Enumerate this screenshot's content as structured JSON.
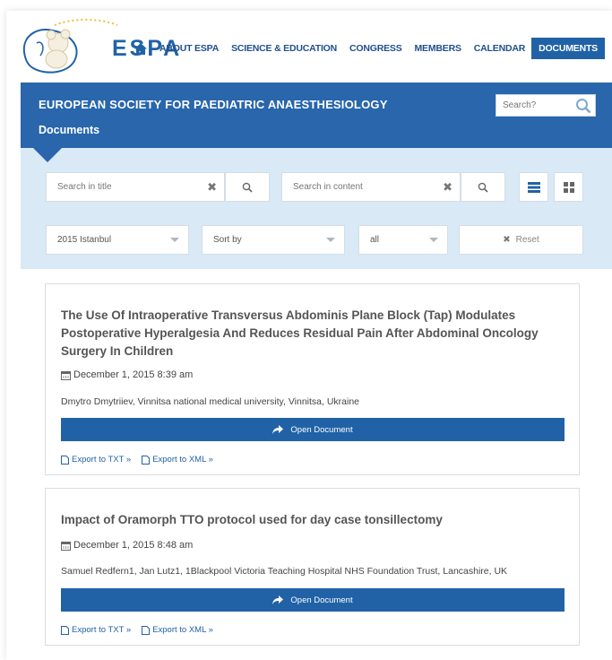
{
  "brand": {
    "name": "ESPA"
  },
  "nav": {
    "items": [
      "ABOUT ESPA",
      "SCIENCE & EDUCATION",
      "CONGRESS",
      "MEMBERS",
      "CALENDAR",
      "DOCUMENTS"
    ],
    "active": "DOCUMENTS"
  },
  "banner": {
    "title": "EUROPEAN SOCIETY FOR PAEDIATRIC ANAESTHESIOLOGY",
    "subtitle": "Documents",
    "search_placeholder": "Search?"
  },
  "filters": {
    "title_placeholder": "Search in title",
    "content_placeholder": "Search in content",
    "event_select": "2015 Istanbul",
    "sort_select": "Sort by",
    "scope_select": "all",
    "reset_label": "Reset"
  },
  "documents": [
    {
      "title": "The Use Of Intraoperative Transversus Abdominis Plane Block (Tap) Modulates Postoperative Hyperalgesia And Reduces Residual Pain After Abdominal Oncology Surgery In Children",
      "date": "December 1, 2015 8:39 am",
      "authors": "Dmytro Dmytriiev, Vinnitsa national medical university, Vinnitsa, Ukraine",
      "open_label": "Open Document",
      "export_txt": "Export to TXT »",
      "export_xml": "Export to XML »"
    },
    {
      "title": "Impact of Oramorph TTO protocol used for day case tonsillectomy",
      "date": "December 1, 2015 8:48 am",
      "authors": "Samuel Redfern1, Jan Lutz1, 1Blackpool Victoria Teaching Hospital NHS Foundation Trust, Lancashire, UK",
      "open_label": "Open Document",
      "export_txt": "Export to TXT »",
      "export_xml": "Export to XML »"
    }
  ],
  "colors": {
    "brand_blue": "#2162a6",
    "banner_blue": "#2966ab",
    "filter_bg": "#d9e9f6"
  }
}
